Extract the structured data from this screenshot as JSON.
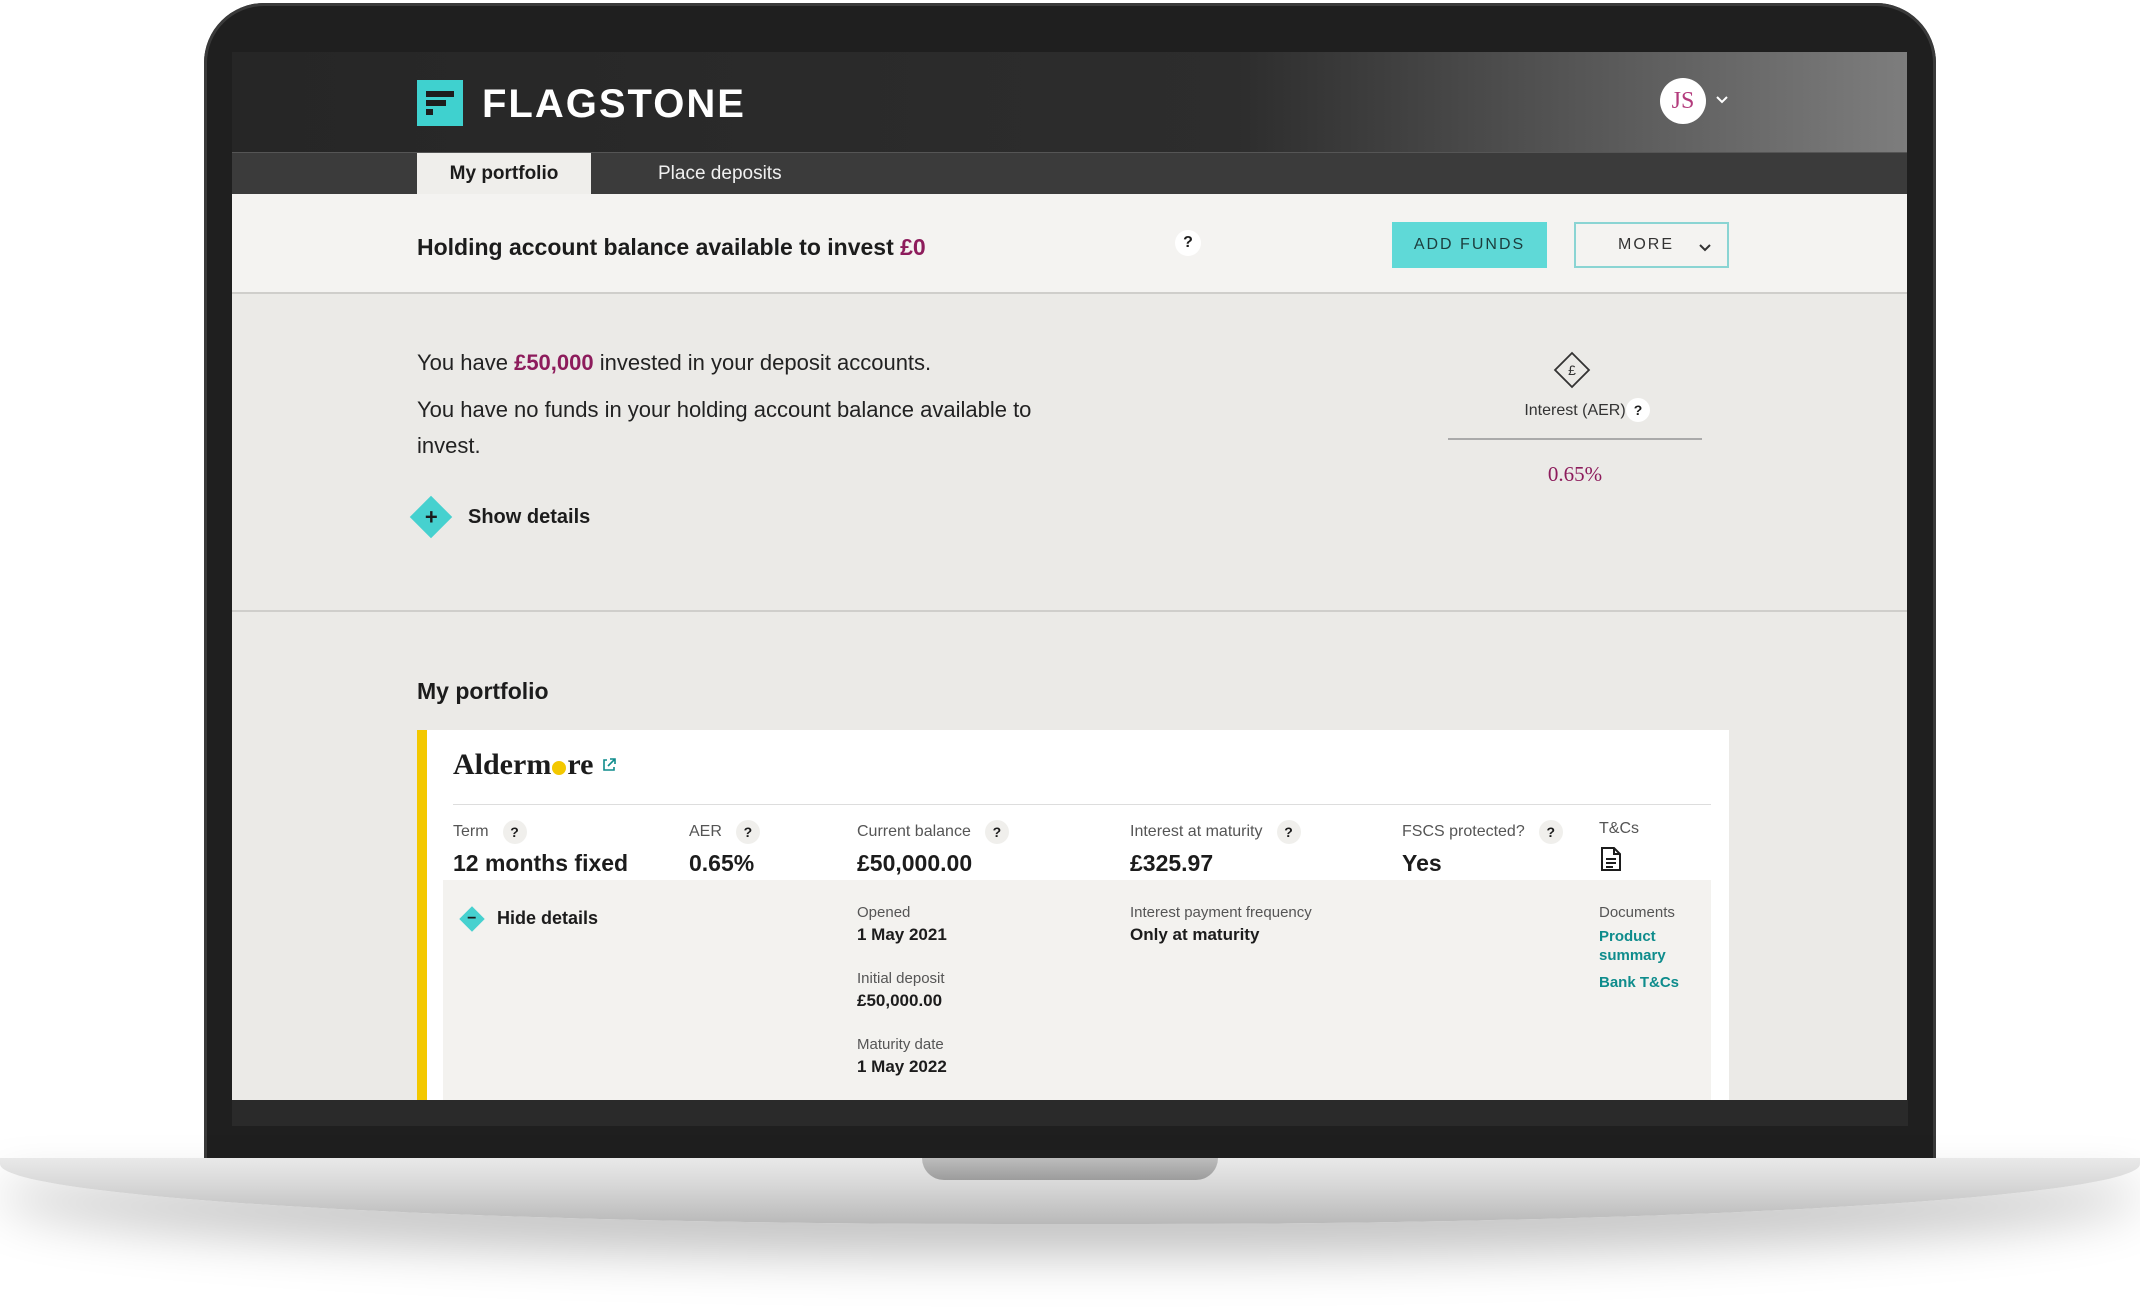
{
  "header": {
    "brand": "FLAGSTONE",
    "avatar_initials": "JS"
  },
  "tabs": [
    {
      "label": "My portfolio",
      "active": true
    },
    {
      "label": "Place deposits",
      "active": false
    }
  ],
  "balance": {
    "label": "Holding account balance available to invest",
    "amount": "£0",
    "help": "?",
    "add_funds": "ADD FUNDS",
    "more": "MORE"
  },
  "summary": {
    "invested_prefix": "You have",
    "invested_amount": "£50,000",
    "invested_suffix": "invested in your deposit accounts.",
    "no_funds": "You have no funds in your holding account balance available to invest.",
    "show_details": "Show details",
    "interest_label": "Interest (AER)",
    "interest_help": "?",
    "interest_value": "0.65%",
    "interest_icon_symbol": "£"
  },
  "portfolio": {
    "title": "My portfolio",
    "bank_name_part1": "Alderm",
    "bank_name_part2": "re",
    "columns": [
      {
        "key": "Term",
        "value": "12 months fixed"
      },
      {
        "key": "AER",
        "value": "0.65%"
      },
      {
        "key": "Current balance",
        "value": "£50,000.00"
      },
      {
        "key": "Interest at maturity",
        "value": "£325.97"
      },
      {
        "key": "FSCS protected?",
        "value": "Yes"
      },
      {
        "key": "T&Cs"
      }
    ],
    "hide_details": "Hide details",
    "details": {
      "opened_label": "Opened",
      "opened_value": "1 May 2021",
      "initial_label": "Initial deposit",
      "initial_value": "£50,000.00",
      "maturity_label": "Maturity date",
      "maturity_value": "1 May 2022",
      "frequency_label": "Interest payment frequency",
      "frequency_value": "Only at maturity",
      "documents_label": "Documents",
      "doc1_line1": "Product",
      "doc1_line2": "summary",
      "doc2": "Bank T&Cs"
    }
  },
  "colors": {
    "accent_teal": "#3fd1cf",
    "accent_magenta": "#8d1c5c",
    "bank_yellow": "#f3c800"
  },
  "icons": [
    "chevron-down-icon",
    "help-icon",
    "plus-icon",
    "minus-icon",
    "external-link-icon",
    "document-icon",
    "pound-diamond-icon"
  ]
}
